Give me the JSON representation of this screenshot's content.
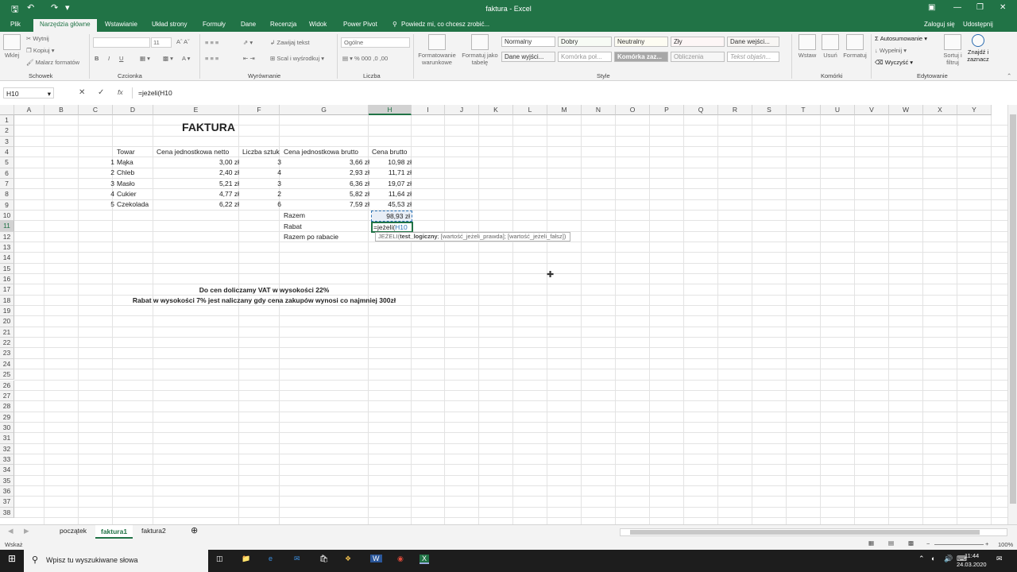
{
  "window": {
    "title": "faktura - Excel"
  },
  "ribbon_tabs": [
    "Plik",
    "Narzędzia główne",
    "Wstawianie",
    "Układ strony",
    "Formuły",
    "Dane",
    "Recenzja",
    "Widok",
    "Power Pivot"
  ],
  "tell_me": "Powiedz mi, co chcesz zrobić...",
  "account": {
    "signin": "Zaloguj się",
    "share": "Udostępnij"
  },
  "ribbon": {
    "clipboard": {
      "paste": "Wklej",
      "cut": "Wytnij",
      "copy": "Kopiuj",
      "painter": "Malarz formatów",
      "label": "Schowek"
    },
    "font": {
      "size": "11",
      "label": "Czcionka"
    },
    "alignment": {
      "wrap": "Zawijaj tekst",
      "merge": "Scal i wyśrodkuj",
      "label": "Wyrównanie"
    },
    "number": {
      "format": "Ogólne",
      "label": "Liczba"
    },
    "styles": {
      "cond": "Formatowanie warunkowe",
      "table": "Formatuj jako tabelę",
      "cells": [
        "Normalny",
        "Dobry",
        "Neutralny",
        "Zły",
        "Dane wejści...",
        "Dane wyjści...",
        "Komórka poł...",
        "Komórka zaz...",
        "Obliczenia",
        "Tekst objaśn..."
      ],
      "label": "Style"
    },
    "cells": {
      "insert": "Wstaw",
      "delete": "Usuń",
      "format": "Formatuj",
      "label": "Komórki"
    },
    "editing": {
      "autosum": "Autosumowanie",
      "fill": "Wypełnij",
      "clear": "Wyczyść",
      "sort": "Sortuj i filtruj",
      "find": "Znajdź i zaznacz",
      "label": "Edytowanie"
    }
  },
  "formula_bar": {
    "namebox": "H10",
    "formula": "=jeżeli(H10"
  },
  "columns": [
    "A",
    "B",
    "C",
    "D",
    "E",
    "F",
    "G",
    "H",
    "I",
    "J",
    "K",
    "L",
    "M",
    "N",
    "O",
    "P",
    "Q",
    "R",
    "S",
    "T",
    "U",
    "V",
    "W",
    "X",
    "Y"
  ],
  "rows": [
    "1",
    "2",
    "3",
    "4",
    "5",
    "6",
    "7",
    "8",
    "9",
    "10",
    "11",
    "12",
    "13",
    "14",
    "15",
    "16",
    "17",
    "18",
    "19",
    "20",
    "21",
    "22",
    "23",
    "24",
    "25",
    "26",
    "27",
    "28",
    "29",
    "30",
    "31",
    "32",
    "33",
    "34",
    "35",
    "36",
    "37",
    "38"
  ],
  "sheet": {
    "title": "FAKTURA",
    "headers": [
      "Towar",
      "Cena jednostkowa netto",
      "Liczba sztuk",
      "Cena jednostkowa brutto",
      "Cena brutto"
    ],
    "items": [
      {
        "no": "1",
        "name": "Mąka",
        "net": "3,00 zł",
        "qty": "3",
        "gross_unit": "3,66 zł",
        "gross": "10,98 zł"
      },
      {
        "no": "2",
        "name": "Chleb",
        "net": "2,40 zł",
        "qty": "4",
        "gross_unit": "2,93 zł",
        "gross": "11,71 zł"
      },
      {
        "no": "3",
        "name": "Masło",
        "net": "5,21 zł",
        "qty": "3",
        "gross_unit": "6,36 zł",
        "gross": "19,07 zł"
      },
      {
        "no": "4",
        "name": "Cukier",
        "net": "4,77 zł",
        "qty": "2",
        "gross_unit": "5,82 zł",
        "gross": "11,64 zł"
      },
      {
        "no": "5",
        "name": "Czekolada",
        "net": "6,22 zł",
        "qty": "6",
        "gross_unit": "7,59 zł",
        "gross": "45,53 zł"
      }
    ],
    "sum_label": "Razem",
    "sum_value": "98,93 zł",
    "discount_label": "Rabat",
    "editing_prefix": "=jeżeli(",
    "editing_ref": "H10",
    "after_discount_label": "Razem po rabacie",
    "note1": "Do cen doliczamy VAT w wysokości 22%",
    "note2": "Rabat w wysokości 7% jest naliczany gdy cena zakupów wynosi co najmniej 300zł"
  },
  "tooltip": {
    "fn": "JEŻELI(",
    "arg1": "test_logiczny",
    "rest": "; [wartość_jeżeli_prawda]; [wartość_jeżeli_fałsz])"
  },
  "sheet_tabs": [
    "początek",
    "faktura1",
    "faktura2"
  ],
  "status": {
    "mode": "Wskaż",
    "zoom": "100%"
  },
  "taskbar": {
    "search": "Wpisz tu wyszukiwane słowa",
    "time": "11:44",
    "date": "24.03.2020"
  },
  "colors": {
    "excel_green": "#217346",
    "sel_border": "#217346",
    "copy_marquee": "#2e75b6"
  }
}
